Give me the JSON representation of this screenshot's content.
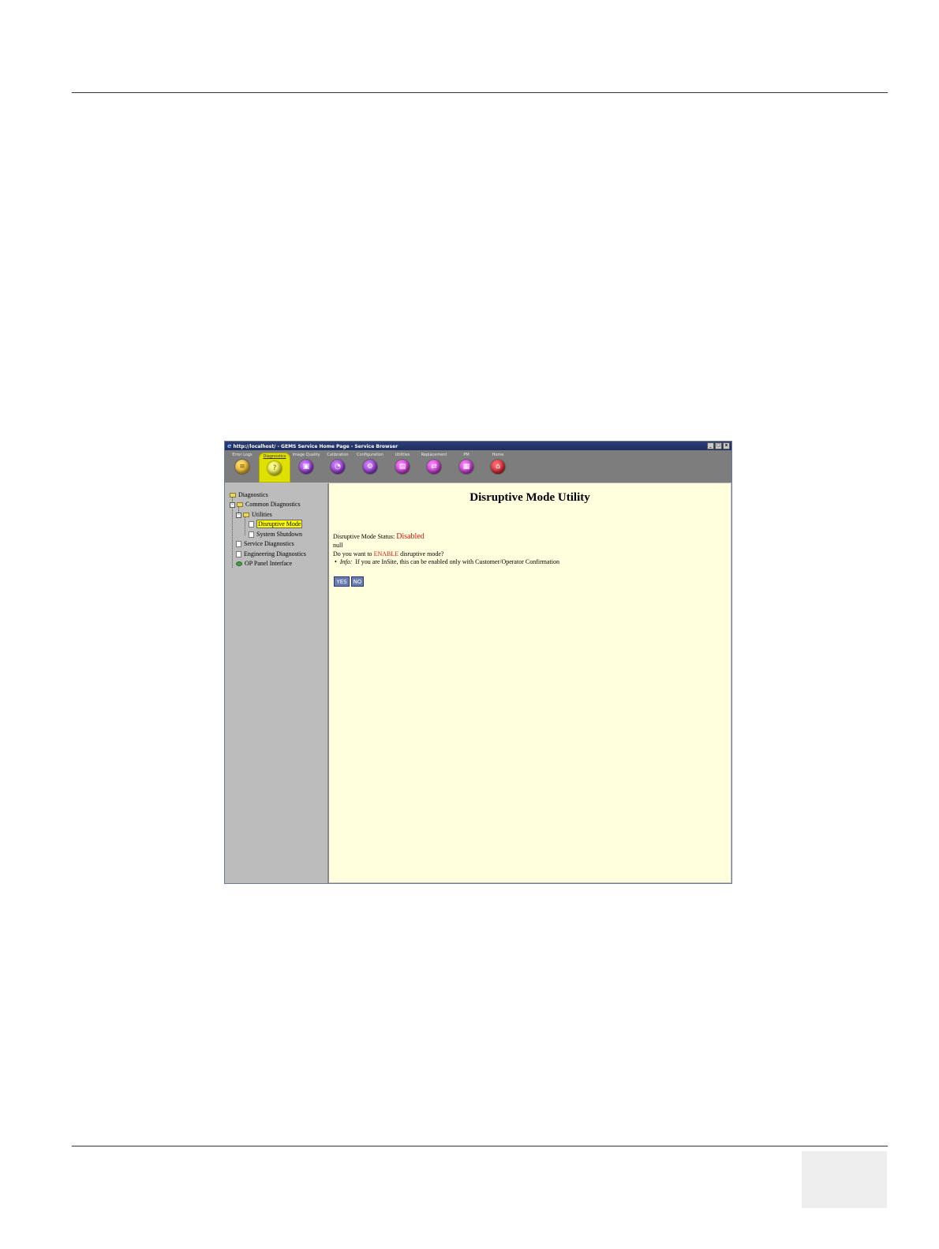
{
  "window": {
    "title": "http://localhost/ - GEMS Service Home Page - Service Browser",
    "controls": [
      "_",
      "□",
      "x"
    ]
  },
  "toolbar": {
    "items": [
      {
        "label": "Error Logs",
        "icon": "list-icon",
        "color": "#e4a400",
        "glyph": "≡"
      },
      {
        "label": "Diagnostics",
        "icon": "question-icon",
        "color": "#d8d800",
        "glyph": "?",
        "active": true
      },
      {
        "label": "Image Quality",
        "icon": "image-icon",
        "color": "#7a10c8",
        "glyph": "▣"
      },
      {
        "label": "Calibration",
        "icon": "calibration-icon",
        "color": "#7a10c8",
        "glyph": "◔"
      },
      {
        "label": "Configuration",
        "icon": "configuration-icon",
        "color": "#7a10c8",
        "glyph": "⚙"
      },
      {
        "label": "Utilities",
        "icon": "utilities-icon",
        "color": "#7a10c8",
        "glyph": "▤"
      },
      {
        "label": "Replacement",
        "icon": "replacement-icon",
        "color": "#b010c0",
        "glyph": "⇄"
      },
      {
        "label": "PM",
        "icon": "pm-icon",
        "color": "#b010c0",
        "glyph": "▦"
      },
      {
        "label": "Home",
        "icon": "home-icon",
        "color": "#c80010",
        "glyph": "⌂"
      }
    ]
  },
  "tree": {
    "root": "Diagnostics",
    "common": "Common Diagnostics",
    "utilities": "Utilities",
    "disruptive": "Disruptive Mode",
    "shutdown": "System Shutdown",
    "service": "Service Diagnostics",
    "engineering": "Engineering Diagnostics",
    "op_panel": "OP Panel Interface"
  },
  "content": {
    "title": "Disruptive Mode Utility",
    "status_label": "Disruptive Mode Status:",
    "status_value": "Disabled",
    "null_text": "null",
    "question_prefix": "Do you want to",
    "question_keyword": "ENABLE",
    "question_suffix": "disruptive mode?",
    "info_label": "Info:",
    "info_text": "If you are InSite, this can be enabled only with Customer/Operator Confirmation",
    "yes_label": "YES",
    "no_label": "NO"
  }
}
